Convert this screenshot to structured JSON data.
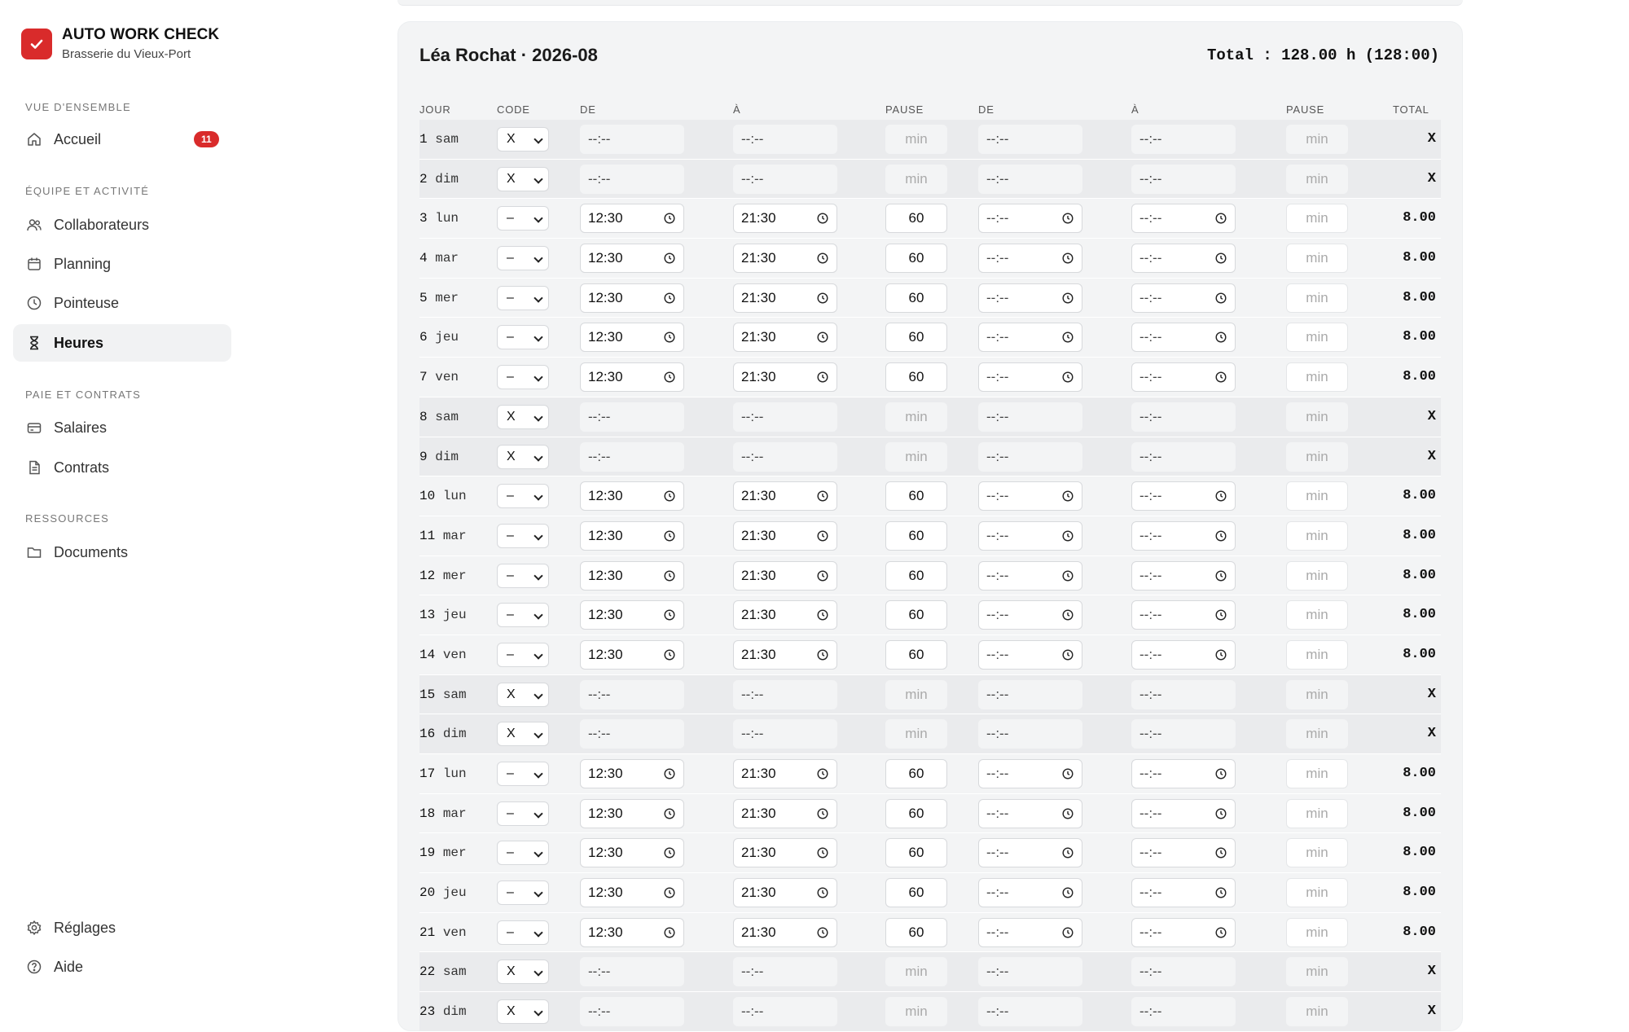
{
  "app": {
    "name": "AUTO WORK CHECK",
    "company": "Brasserie du Vieux-Port"
  },
  "sidebar": {
    "sections": [
      "VUE D'ENSEMBLE",
      "ÉQUIPE ET ACTIVITÉ",
      "PAIE ET CONTRATS",
      "RESSOURCES"
    ],
    "items": [
      {
        "label": "Accueil",
        "icon": "home-icon",
        "badge": "11"
      },
      {
        "label": "Collaborateurs",
        "icon": "users-icon"
      },
      {
        "label": "Planning",
        "icon": "calendar-icon"
      },
      {
        "label": "Pointeuse",
        "icon": "clock-icon"
      },
      {
        "label": "Heures",
        "icon": "hourglass-icon",
        "active": true
      },
      {
        "label": "Salaires",
        "icon": "credit-card-icon"
      },
      {
        "label": "Contrats",
        "icon": "document-icon"
      },
      {
        "label": "Documents",
        "icon": "folder-icon"
      }
    ],
    "footer": [
      {
        "label": "Réglages",
        "icon": "gear-icon"
      },
      {
        "label": "Aide",
        "icon": "help-icon"
      }
    ]
  },
  "timesheet": {
    "title": "Léa Rochat · 2026-08",
    "total": "Total : 128.00 h (128:00)",
    "columns": [
      "JOUR",
      "CODE",
      "DE",
      "À",
      "PAUSE",
      "DE",
      "À",
      "PAUSE",
      "TOTAL"
    ],
    "empty_time": "--:--",
    "pause_placeholder": "min",
    "rows": [
      {
        "n": "1",
        "d": "sam",
        "code": "X",
        "off": true,
        "total": "X"
      },
      {
        "n": "2",
        "d": "dim",
        "code": "X",
        "off": true,
        "total": "X"
      },
      {
        "n": "3",
        "d": "lun",
        "code": "–",
        "de": "12:30",
        "a": "21:30",
        "pause": "60",
        "total": "8.00"
      },
      {
        "n": "4",
        "d": "mar",
        "code": "–",
        "de": "12:30",
        "a": "21:30",
        "pause": "60",
        "total": "8.00"
      },
      {
        "n": "5",
        "d": "mer",
        "code": "–",
        "de": "12:30",
        "a": "21:30",
        "pause": "60",
        "total": "8.00"
      },
      {
        "n": "6",
        "d": "jeu",
        "code": "–",
        "de": "12:30",
        "a": "21:30",
        "pause": "60",
        "total": "8.00"
      },
      {
        "n": "7",
        "d": "ven",
        "code": "–",
        "de": "12:30",
        "a": "21:30",
        "pause": "60",
        "total": "8.00"
      },
      {
        "n": "8",
        "d": "sam",
        "code": "X",
        "off": true,
        "total": "X"
      },
      {
        "n": "9",
        "d": "dim",
        "code": "X",
        "off": true,
        "total": "X"
      },
      {
        "n": "10",
        "d": "lun",
        "code": "–",
        "de": "12:30",
        "a": "21:30",
        "pause": "60",
        "total": "8.00"
      },
      {
        "n": "11",
        "d": "mar",
        "code": "–",
        "de": "12:30",
        "a": "21:30",
        "pause": "60",
        "total": "8.00"
      },
      {
        "n": "12",
        "d": "mer",
        "code": "–",
        "de": "12:30",
        "a": "21:30",
        "pause": "60",
        "total": "8.00"
      },
      {
        "n": "13",
        "d": "jeu",
        "code": "–",
        "de": "12:30",
        "a": "21:30",
        "pause": "60",
        "total": "8.00"
      },
      {
        "n": "14",
        "d": "ven",
        "code": "–",
        "de": "12:30",
        "a": "21:30",
        "pause": "60",
        "total": "8.00"
      },
      {
        "n": "15",
        "d": "sam",
        "code": "X",
        "off": true,
        "total": "X"
      },
      {
        "n": "16",
        "d": "dim",
        "code": "X",
        "off": true,
        "total": "X"
      },
      {
        "n": "17",
        "d": "lun",
        "code": "–",
        "de": "12:30",
        "a": "21:30",
        "pause": "60",
        "total": "8.00"
      },
      {
        "n": "18",
        "d": "mar",
        "code": "–",
        "de": "12:30",
        "a": "21:30",
        "pause": "60",
        "total": "8.00"
      },
      {
        "n": "19",
        "d": "mer",
        "code": "–",
        "de": "12:30",
        "a": "21:30",
        "pause": "60",
        "total": "8.00"
      },
      {
        "n": "20",
        "d": "jeu",
        "code": "–",
        "de": "12:30",
        "a": "21:30",
        "pause": "60",
        "total": "8.00"
      },
      {
        "n": "21",
        "d": "ven",
        "code": "–",
        "de": "12:30",
        "a": "21:30",
        "pause": "60",
        "total": "8.00"
      },
      {
        "n": "22",
        "d": "sam",
        "code": "X",
        "off": true,
        "total": "X"
      },
      {
        "n": "23",
        "d": "dim",
        "code": "X",
        "off": true,
        "total": "X"
      }
    ]
  }
}
